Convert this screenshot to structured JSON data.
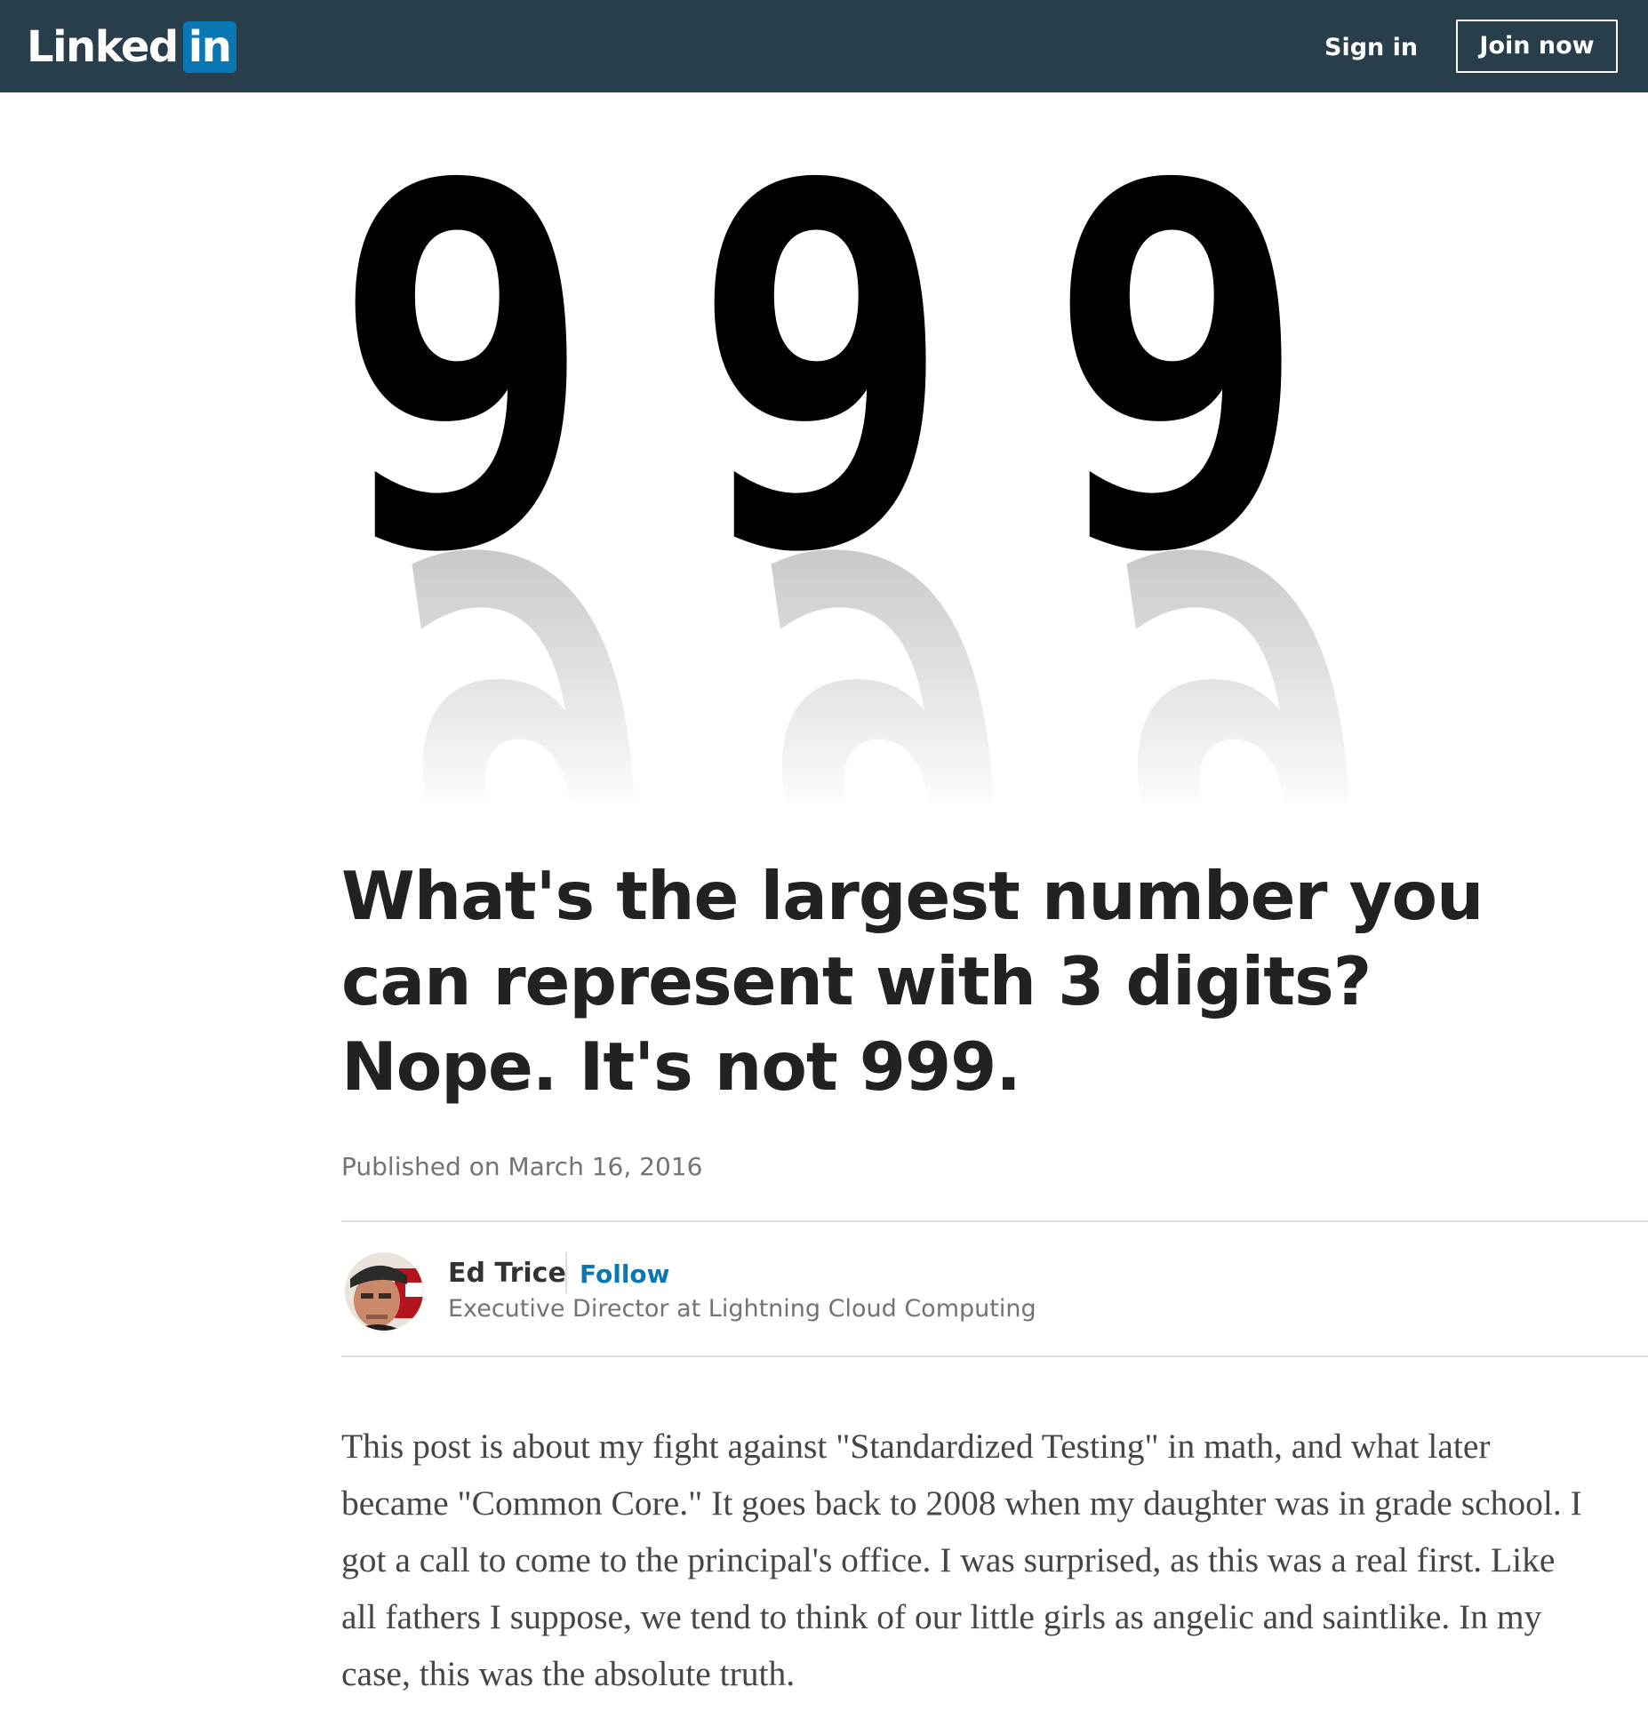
{
  "header": {
    "logo_linked": "Linked",
    "logo_in": "in",
    "sign_in": "Sign in",
    "join_now": "Join now"
  },
  "hero": {
    "digits": [
      "9",
      "9",
      "9"
    ]
  },
  "article": {
    "title": "What's the largest number you can represent with 3 digits? Nope. It's not 999.",
    "published": "Published on March 16, 2016",
    "author": {
      "name": "Ed Trice",
      "follow_label": "Follow",
      "headline": "Executive Director at Lightning Cloud Computing"
    },
    "body_lines": [
      "This post is about my fight against \"Standardized Testing\" in math, and what later",
      "became \"Common Core.\" It goes back to 2008 when my daughter was in grade school. I",
      "got a call to come to the principal's office. I was surprised, as this was a real first. Like",
      "all fathers I suppose, we tend to think of our little girls as angelic and saintlike. In my",
      "case, this was the absolute truth."
    ]
  },
  "colors": {
    "topbar": "#283e4a",
    "brand_blue": "#0a77b5",
    "title_text": "#222222",
    "muted_text": "#737373"
  }
}
